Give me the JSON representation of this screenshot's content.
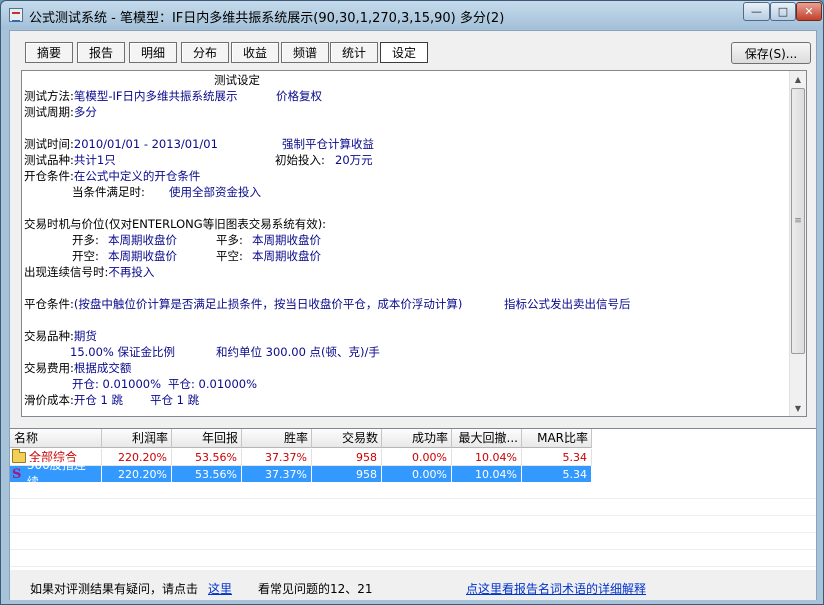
{
  "window": {
    "title": "公式测试系统 - 笔模型：IF日内多维共振系统展示(90,30,1,270,3,15,90) 多分(2)",
    "controls": {
      "min": "—",
      "max": "□",
      "close": "✕"
    }
  },
  "tabs": [
    {
      "label": "摘要"
    },
    {
      "label": "报告"
    },
    {
      "label": "明细"
    },
    {
      "label": "分布"
    },
    {
      "label": "收益"
    },
    {
      "label": "频谱"
    },
    {
      "label": "统计"
    },
    {
      "label": "设定",
      "active": true
    }
  ],
  "save_button": "保存(S)...",
  "settings_text": {
    "heading": "测试设定",
    "method_label": "测试方法:",
    "method_value": "笔模型-IF日内多维共振系统展示",
    "method_extra": "价格复权",
    "period_label": "测试周期:",
    "period_value": "多分",
    "time_label": "测试时间:",
    "time_value": "2010/01/01 - 2013/01/01",
    "force_close": "强制平仓计算收益",
    "variety_label": "测试品种:",
    "variety_value": "共计1只",
    "init_label": "初始投入:",
    "init_value": "20万元",
    "open_label": "开仓条件:",
    "open_value": "在公式中定义的开仓条件",
    "cond_label": "当条件满足时:",
    "cond_value": "使用全部资金投入",
    "timing_label": "交易时机与价位(仅对ENTERLONG等旧图表交易系统有效):",
    "open_long_label": "开多:",
    "open_long_value": "本周期收盘价",
    "close_long_label": "平多:",
    "close_long_value": "本周期收盘价",
    "open_short_label": "开空:",
    "open_short_value": "本周期收盘价",
    "close_short_label": "平空:",
    "close_short_value": "本周期收盘价",
    "repeat_label": "出现连续信号时:",
    "repeat_value": "不再投入",
    "close_cond_label": "平仓条件:",
    "close_cond_value": "(按盘中触位价计算是否满足止损条件，按当日收盘价平仓，成本价浮动计算)",
    "close_cond_extra": "指标公式发出卖出信号后",
    "trade_variety_label": "交易品种:",
    "trade_variety_value": "期货",
    "margin_value": "15.00% 保证金比例",
    "contract_value": "和约单位 300.00 点(顿、克)/手",
    "fee_label": "交易费用:",
    "fee_value": "根据成交额",
    "fee_open": "开仓: 0.01000%",
    "fee_close": "平仓: 0.01000%",
    "slip_label": "滑价成本:",
    "slip_open": "开仓 1 跳",
    "slip_close": "平仓 1 跳"
  },
  "grid": {
    "headers": [
      "名称",
      "利润率",
      "年回报",
      "胜率",
      "交易数",
      "成功率",
      "最大回撤...",
      "MAR比率"
    ],
    "rows": [
      {
        "name": "全部综合",
        "icon": "folder-icon",
        "values": [
          "220.20%",
          "53.56%",
          "37.37%",
          "958",
          "0.00%",
          "10.04%",
          "5.34"
        ]
      },
      {
        "name": "300股指连续",
        "icon": "s-icon",
        "values": [
          "220.20%",
          "53.56%",
          "37.37%",
          "958",
          "0.00%",
          "10.04%",
          "5.34"
        ],
        "selected": true
      }
    ]
  },
  "status": {
    "question": "如果对评测结果有疑问，请点击",
    "here_link": "这里",
    "see_faq": "看常见问题的12、21",
    "glossary_link": "点这里看报告名词术语的详细解释"
  },
  "colors": {
    "selected_row": "#3399ff",
    "value_red": "#cc0000",
    "text_blue": "#0a0a8c",
    "link": "#0033cc"
  }
}
